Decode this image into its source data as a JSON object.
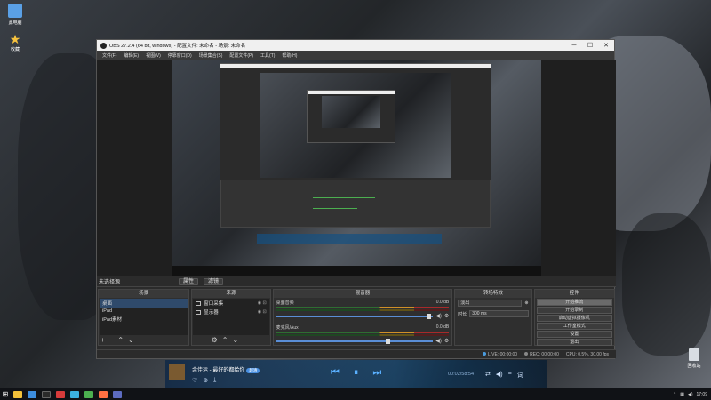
{
  "desktop": {
    "icons": [
      {
        "label": "此电脑",
        "icon": "computer-icon"
      },
      {
        "label": "收藏",
        "icon": "star-icon"
      }
    ],
    "recycle_bin": {
      "label": "回收站",
      "icon": "recycle-bin-icon"
    }
  },
  "window": {
    "title": "OBS 27.2.4 (64 bit, windows) - 配置文件: 未命名 - 场景: 未命名",
    "controls": {
      "minimize": "─",
      "maximize": "☐",
      "close": "✕"
    }
  },
  "menubar": [
    "文件(F)",
    "编辑(E)",
    "视图(V)",
    "停靠窗口(D)",
    "场景集合(S)",
    "配置文件(P)",
    "工具(T)",
    "帮助(H)"
  ],
  "scene_bar": {
    "label": "未选择源",
    "properties": "属性",
    "filters": "滤镜"
  },
  "docks": {
    "scenes": {
      "title": "场景",
      "items": [
        "桌面",
        "iPad",
        "iPad素材"
      ],
      "selected": 0
    },
    "sources": {
      "title": "来源",
      "items": [
        "窗口采集",
        "显示器"
      ],
      "selected": 0
    },
    "mixer": {
      "title": "混音器",
      "tracks": [
        {
          "name": "桌面音频",
          "db": "0.0 dB",
          "volume": 0.97
        },
        {
          "name": "麦克风/Aux",
          "db": "0.0 dB",
          "volume": 0.7
        }
      ]
    },
    "transitions": {
      "title": "转场特效",
      "type": "淡出",
      "duration_label": "时长",
      "duration": "300 ms"
    },
    "controls": {
      "title": "控件",
      "buttons": [
        "开始推流",
        "开始录制",
        "启动虚拟摄像机",
        "工作室模式",
        "设置",
        "退出"
      ],
      "highlighted": 0
    }
  },
  "statusbar": {
    "live": "LIVE: 00:00:00",
    "rec": "REC: 00:00:00",
    "cpu": "CPU: 0.5%, 30.00 fps"
  },
  "player": {
    "song": "余佳运 - 最好的都给你",
    "badge": "超清",
    "time": "00:02/58:54",
    "left_icons": [
      "♡",
      "⊕",
      "⤓",
      "⋯"
    ],
    "controls": {
      "prev": "⏮",
      "play": "⏸",
      "next": "⏭"
    },
    "right_icons": [
      "⇄",
      "◀)",
      "≡",
      "词"
    ]
  },
  "taskbar": {
    "start": "⊞",
    "icon_colors": [
      "#f3c13a",
      "#3c8dde",
      "#2b2b2b",
      "#d83b3b",
      "#3bb0e0",
      "#4caf50",
      "#ff7043",
      "#5c6bc0"
    ],
    "clock": "17:09"
  }
}
